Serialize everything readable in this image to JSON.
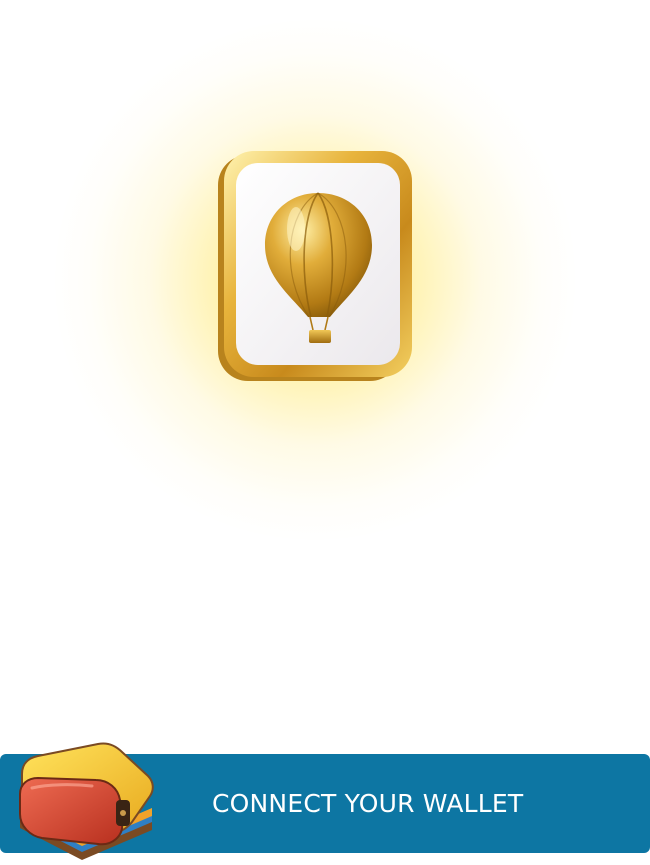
{
  "hero": {
    "icon": "hot-air-balloon-icon",
    "colors": {
      "glow": "#ffe250",
      "frame_gold": "#e4b23a",
      "tile": "#f6f4f6"
    }
  },
  "connect_button": {
    "label": "CONNECT YOUR WALLET",
    "icon": "wallet-icon",
    "background": "#0d76a3",
    "text_color": "#ffffff"
  }
}
